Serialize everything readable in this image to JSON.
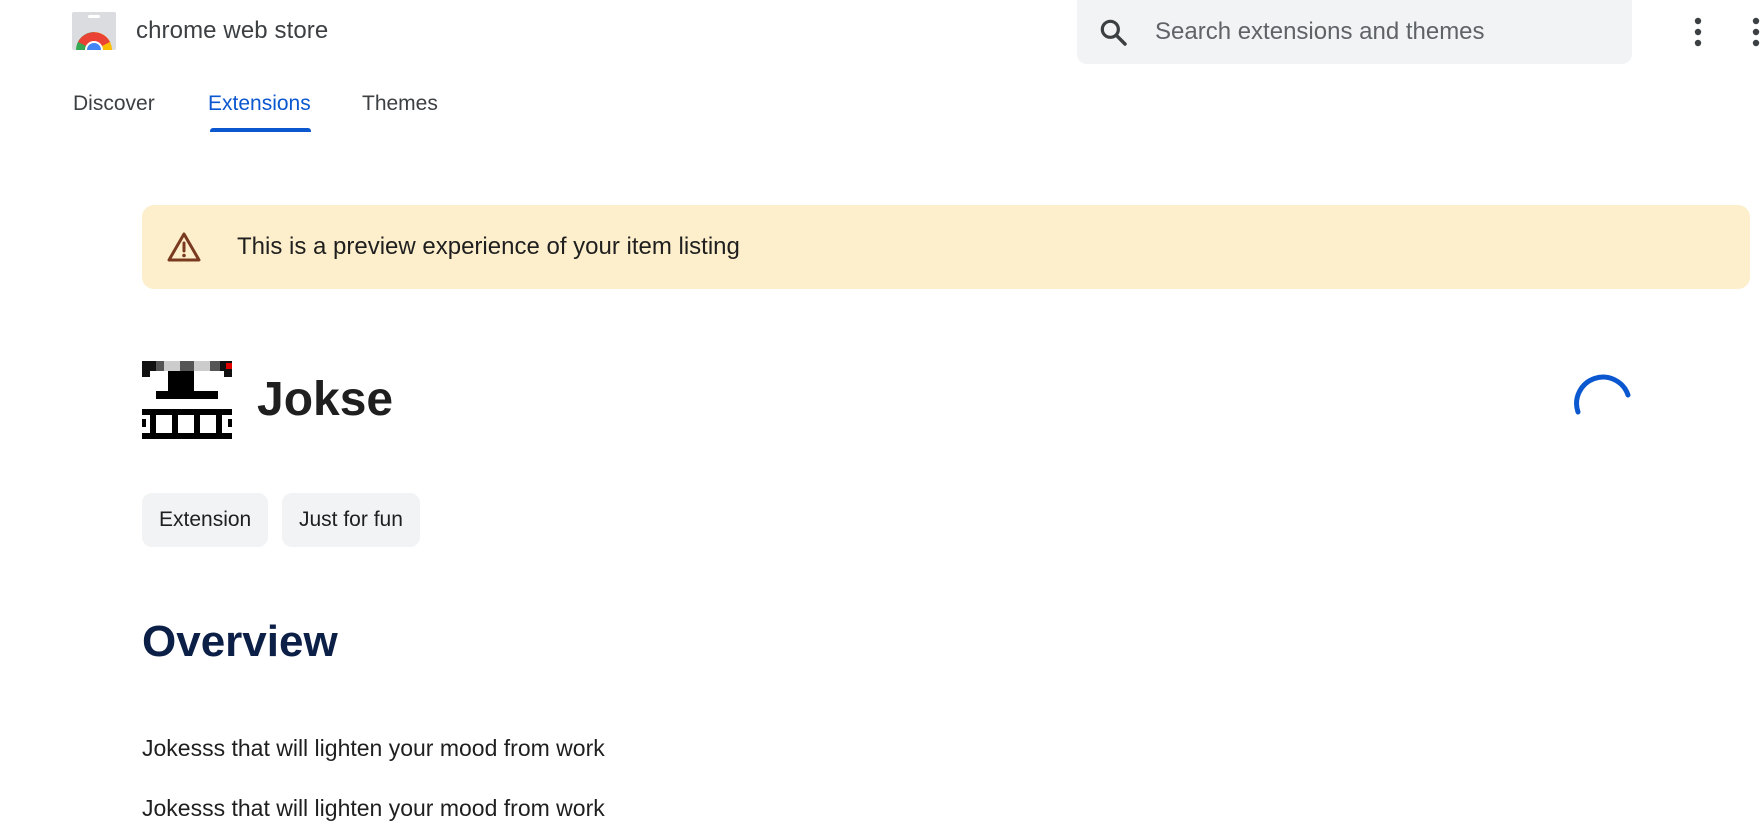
{
  "header": {
    "brand": "chrome web store",
    "search_placeholder": "Search extensions and themes",
    "search_value": ""
  },
  "tabs": [
    {
      "label": "Discover",
      "active": false
    },
    {
      "label": "Extensions",
      "active": true
    },
    {
      "label": "Themes",
      "active": false
    }
  ],
  "banner": {
    "text": "This is a preview experience of your item listing"
  },
  "item": {
    "title": "Jokse",
    "chips": [
      "Extension",
      "Just for fun"
    ]
  },
  "overview": {
    "heading": "Overview",
    "lines": [
      "Jokesss that will lighten your mood from work",
      "Jokesss that will lighten your mood from work"
    ]
  },
  "icons": {
    "logo": "chrome-web-store-logo",
    "search": "search-icon",
    "more": "more-vert-icon",
    "apps": "apps-icon",
    "warning": "warning-icon",
    "item": "jokse-item-icon",
    "loading": "loading-spinner"
  },
  "colors": {
    "accent": "#0b57d0",
    "banner_bg": "#feefcc",
    "warning": "#7a3a1f",
    "heading": "#0c1f47",
    "chip_bg": "#f1f3f4"
  }
}
